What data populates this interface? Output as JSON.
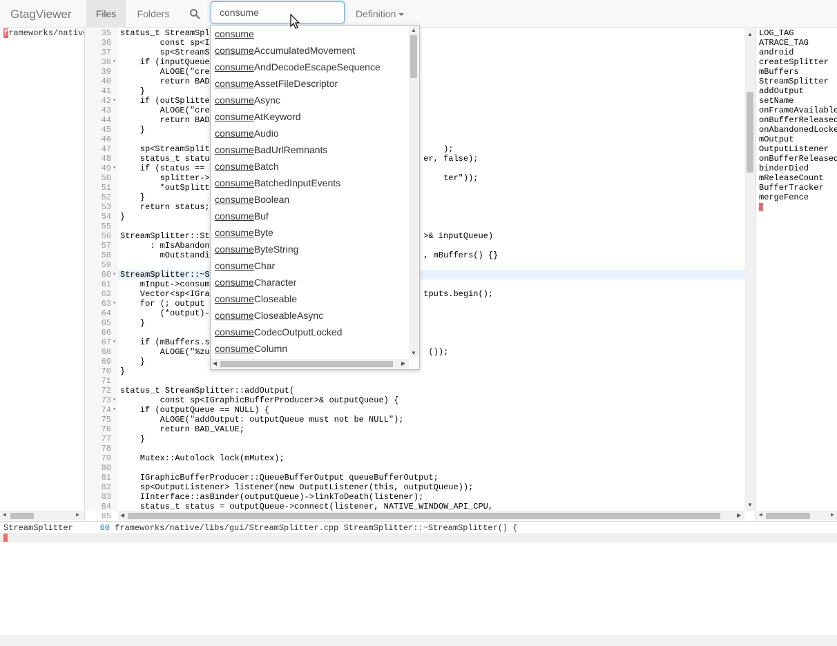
{
  "navbar": {
    "brand": "GtagViewer",
    "tabs": [
      {
        "label": "Files"
      },
      {
        "label": "Folders"
      }
    ],
    "search_value": "consume",
    "definition_label": "Definition"
  },
  "file_pane": {
    "path_first_char": "f",
    "path_rest": "rameworks/native"
  },
  "gutter": {
    "lines": [
      "35",
      "36",
      "37",
      "38",
      "39",
      "40",
      "41",
      "42",
      "43",
      "44",
      "45",
      "46",
      "47",
      "48",
      "49",
      "50",
      "51",
      "52",
      "53",
      "54",
      "55",
      "56",
      "57",
      "58",
      "59",
      "60",
      "61",
      "62",
      "63",
      "64",
      "65",
      "66",
      "67",
      "68",
      "69",
      "70",
      "71",
      "72",
      "73",
      "74",
      "75",
      "76",
      "77",
      "78",
      "79",
      "80",
      "81",
      "82",
      "83",
      "84",
      "85"
    ]
  },
  "code": {
    "lines": [
      "status_t StreamSplitter",
      "        const sp<IG",
      "        sp<StreamSp",
      "    if (inputQueue",
      "        ALOGE(\"crea",
      "        return BAD_",
      "    }",
      "    if (outSplitter",
      "        ALOGE(\"crea",
      "        return BAD_",
      "    }",
      "",
      "    sp<StreamSplitt                                              );",
      "    status_t status                                          er, false);",
      "    if (status == N",
      "        splitter->m                                              ter\"));",
      "        *outSplitte",
      "    }",
      "    return status;",
      "}",
      "",
      "StreamSplitter::Str                                          >& inputQueue)",
      "      : mIsAbandone",
      "        mOutstandin                                          , mBuffers() {}",
      "",
      "StreamSplitter::~St",
      "    mInput->consume",
      "    Vector<sp<IGrap                                          tputs.begin();",
      "    for (; output !",
      "        (*output)->",
      "    }",
      "",
      "    if (mBuffers.si",
      "        ALOGE(\"%zu                                            ());",
      "    }",
      "}",
      "",
      "status_t StreamSplitter::addOutput(",
      "        const sp<IGraphicBufferProducer>& outputQueue) {",
      "    if (outputQueue == NULL) {",
      "        ALOGE(\"addOutput: outputQueue must not be NULL\");",
      "        return BAD_VALUE;",
      "    }",
      "",
      "    Mutex::Autolock lock(mMutex);",
      "",
      "    IGraphicBufferProducer::QueueBufferOutput queueBufferOutput;",
      "    sp<OutputListener> listener(new OutputListener(this, outputQueue));",
      "    IInterface::asBinder(outputQueue)->linkToDeath(listener);",
      "    status_t status = outputQueue->connect(listener, NATIVE_WINDOW_API_CPU,",
      ""
    ]
  },
  "symbols": [
    "LOG_TAG",
    "ATRACE_TAG",
    "android",
    "createSplitter",
    "mBuffers",
    "StreamSplitter",
    "addOutput",
    "setName",
    "onFrameAvailable",
    "onBufferReleasedByOutput",
    "onAbandonedLocked",
    "mOutput",
    "OutputListener",
    "onBufferReleased",
    "binderDied",
    "mReleaseCount",
    "BufferTracker",
    "mergeFence"
  ],
  "results": {
    "symbol": "StreamSplitter",
    "line": "60",
    "text": "frameworks/native/libs/gui/StreamSplitter.cpp StreamSplitter::~StreamSplitter() {"
  },
  "autocomplete": {
    "prefix": "consume",
    "suffixes": [
      "",
      "AccumulatedMovement",
      "AndDecodeEscapeSequence",
      "AssetFileDescriptor",
      "Async",
      "AtKeyword",
      "Audio",
      "BadUrlRemnants",
      "Batch",
      "BatchedInputEvents",
      "Boolean",
      "Buf",
      "Byte",
      "ByteString",
      "Char",
      "Character",
      "Closeable",
      "CloseableAsync",
      "CodecOutputLocked",
      "Column"
    ]
  }
}
